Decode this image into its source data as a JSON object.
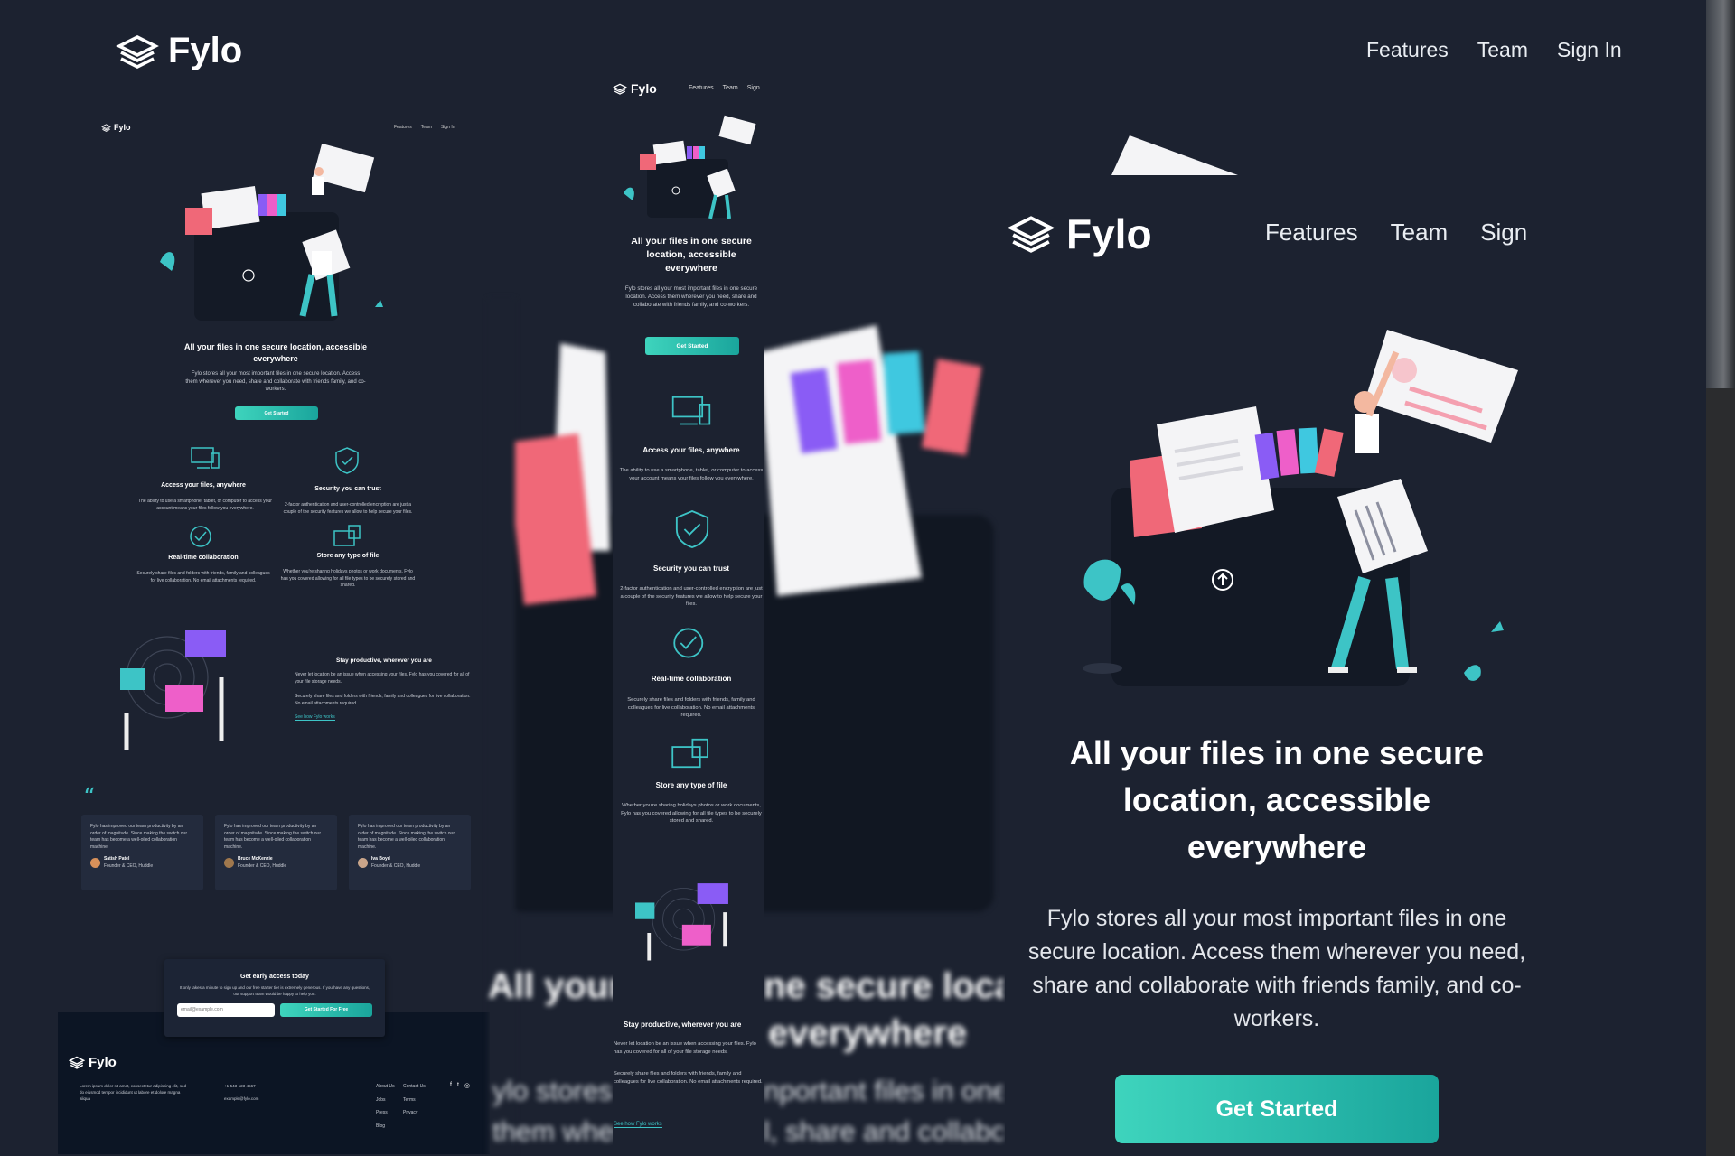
{
  "brand": "Fylo",
  "nav": {
    "features": "Features",
    "team": "Team",
    "signin": "Sign In",
    "sign_short": "Sign"
  },
  "hero": {
    "title": "All your files in one secure location, accessible everywhere",
    "title_l1": "All your files in one secure",
    "title_l2": "location, accessible",
    "title_l3": "everywhere",
    "sub": "Fylo stores all your most important files in one secure location. Access them wherever you need, share and collaborate with friends family, and co-workers.",
    "sub_l1": "Fylo stores all your most important files in one",
    "sub_l2": "secure location. Access them wherever you need,",
    "sub_l3": "share and collaborate with friends family, and co-",
    "sub_l4": "workers.",
    "cta": "Get Started"
  },
  "features": [
    {
      "title": "Access your files, anywhere",
      "text": "The ability to use a smartphone, tablet, or computer to access your account means your files follow you everywhere."
    },
    {
      "title": "Security you can trust",
      "text": "2-factor authentication and user-controlled encryption are just a couple of the security features we allow to help secure your files."
    },
    {
      "title": "Real-time collaboration",
      "text": "Securely share files and folders with friends, family and colleagues for live collaboration. No email attachments required."
    },
    {
      "title": "Store any type of file",
      "text": "Whether you're sharing holidays photos or work documents, Fylo has you covered allowing for all file types to be securely stored and shared."
    }
  ],
  "productive": {
    "title": "Stay productive, wherever you are",
    "p1": "Never let location be an issue when accessing your files. Fylo has you covered for all of your file storage needs.",
    "p2": "Securely share files and folders with friends, family and colleagues for live collaboration. No email attachments required.",
    "link": "See how Fylo works"
  },
  "testimonials": [
    {
      "quote": "Fylo has improved our team productivity by an order of magnitude. Since making the switch our team has become a well-oiled collaboration machine.",
      "name": "Satish Patel",
      "role": "Founder & CEO, Huddle"
    },
    {
      "quote": "Fylo has improved our team productivity by an order of magnitude. Since making the switch our team has become a well-oiled collaboration machine.",
      "name": "Bruce McKenzie",
      "role": "Founder & CEO, Huddle"
    },
    {
      "quote": "Fylo has improved our team productivity by an order of magnitude. Since making the switch our team has become a well-oiled collaboration machine.",
      "name": "Iva Boyd",
      "role": "Founder & CEO, Huddle"
    }
  ],
  "quote_mark": "“",
  "access": {
    "title": "Get early access today",
    "text": "It only takes a minute to sign up and our free starter tier is extremely generous. If you have any questions, our support team would be happy to help you.",
    "placeholder": "email@example.com",
    "button": "Get Started For Free"
  },
  "footer": {
    "address": "Lorem ipsum dolor sit amet, consectetur adipiscing elit, sed do eiusmod tempor incididunt ut labore et dolore magna aliqua",
    "phone": "+1-543-123-4567",
    "email": "example@fylo.com",
    "col1": [
      "About Us",
      "Jobs",
      "Press",
      "Blog"
    ],
    "col2": [
      "Contact Us",
      "Terms",
      "Privacy"
    ]
  },
  "blur": {
    "t1": "All your",
    "t2": "ne secure locat",
    "t3": "everywhere",
    "t4": "ylo stores a",
    "t5": "them wher",
    "t6": "nportant files in one s",
    "t7": "l, share and collabora"
  },
  "colors": {
    "bg": "#1c2230",
    "card": "#232b3d",
    "teal": "#3ed4bd",
    "footer": "#0c1524"
  }
}
